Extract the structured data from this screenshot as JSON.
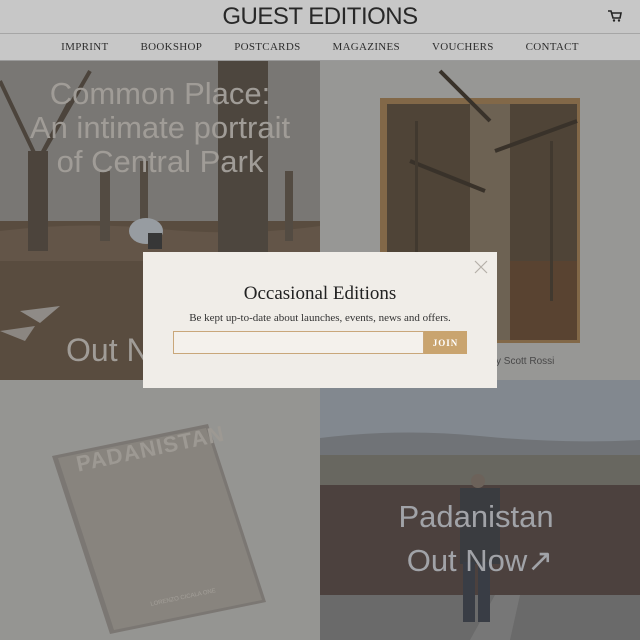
{
  "header": {
    "logo": "GUEST EDITIONS",
    "cart_icon": "cart-icon"
  },
  "nav": {
    "items": [
      {
        "label": "IMPRINT"
      },
      {
        "label": "BOOKSHOP"
      },
      {
        "label": "POSTCARDS"
      },
      {
        "label": "MAGAZINES"
      },
      {
        "label": "VOUCHERS"
      },
      {
        "label": "CONTACT"
      }
    ]
  },
  "tiles": {
    "common_place": {
      "title_line1": "Common Place:",
      "title_line2": "An intimate portrait",
      "title_line3": "of Central Park",
      "cta": "Out N"
    },
    "book_cover": {
      "caption": "y Scott Rossi"
    },
    "padanistan_book": {
      "cover_title": "PADANISTAN",
      "cover_author": "LORENZO CICALA ONE"
    },
    "padanistan_photo": {
      "title": "Padanistan",
      "cta": "Out Now↗"
    }
  },
  "modal": {
    "title": "Occasional Editions",
    "text": "Be kept up-to-date about launches, events, news and offers.",
    "email_value": "",
    "email_placeholder": "",
    "join_label": "JOIN",
    "close_icon": "close-icon"
  },
  "colors": {
    "accent": "#c9a46f",
    "overlay": "#505050",
    "modal_bg": "#f0ede8"
  }
}
